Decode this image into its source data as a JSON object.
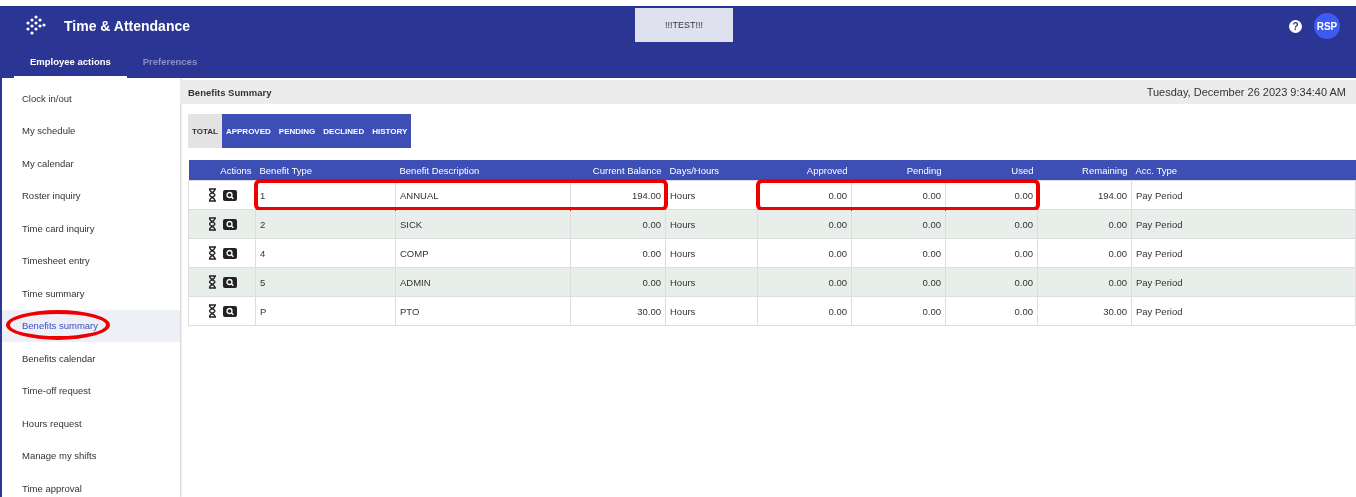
{
  "app": {
    "title": "Time & Attendance",
    "environment_badge": "!!!TEST!!!",
    "help": "?",
    "avatar": "RSP"
  },
  "nav_tabs": [
    {
      "label": "Employee actions",
      "selected": true
    },
    {
      "label": "Preferences",
      "selected": false
    }
  ],
  "sidebar": {
    "items": [
      {
        "label": "Clock in/out",
        "selected": false,
        "circled": false
      },
      {
        "label": "My schedule",
        "selected": false,
        "circled": false
      },
      {
        "label": "My calendar",
        "selected": false,
        "circled": false
      },
      {
        "label": "Roster inquiry",
        "selected": false,
        "circled": false
      },
      {
        "label": "Time card inquiry",
        "selected": false,
        "circled": false
      },
      {
        "label": "Timesheet entry",
        "selected": false,
        "circled": false
      },
      {
        "label": "Time summary",
        "selected": false,
        "circled": false
      },
      {
        "label": "Benefits summary",
        "selected": true,
        "circled": true
      },
      {
        "label": "Benefits calendar",
        "selected": false,
        "circled": false
      },
      {
        "label": "Time-off request",
        "selected": false,
        "circled": false
      },
      {
        "label": "Hours request",
        "selected": false,
        "circled": false
      },
      {
        "label": "Manage my shifts",
        "selected": false,
        "circled": false
      },
      {
        "label": "Time approval",
        "selected": false,
        "circled": false
      }
    ]
  },
  "page": {
    "title": "Benefits Summary",
    "datetime": "Tuesday, December 26 2023 9:34:40 AM"
  },
  "view_tabs": [
    {
      "label": "TOTAL",
      "selected": true
    },
    {
      "label": "APPROVED",
      "selected": false
    },
    {
      "label": "PENDING",
      "selected": false
    },
    {
      "label": "DECLINED",
      "selected": false
    },
    {
      "label": "HISTORY",
      "selected": false
    }
  ],
  "table": {
    "columns": [
      {
        "label": "Actions",
        "kind": "actions"
      },
      {
        "label": "Benefit Type",
        "kind": "text"
      },
      {
        "label": "Benefit Description",
        "kind": "text"
      },
      {
        "label": "Current Balance",
        "kind": "number"
      },
      {
        "label": "Days/Hours",
        "kind": "text"
      },
      {
        "label": "Approved",
        "kind": "number"
      },
      {
        "label": "Pending",
        "kind": "number"
      },
      {
        "label": "Used",
        "kind": "number"
      },
      {
        "label": "Remaining",
        "kind": "number"
      },
      {
        "label": "Acc. Type",
        "kind": "text"
      }
    ],
    "rows": [
      {
        "cells": [
          {
            "kind": "actions"
          },
          {
            "kind": "text",
            "text": "1",
            "boxed": true
          },
          {
            "kind": "text",
            "text": "ANNUAL",
            "boxed": true
          },
          {
            "kind": "text",
            "text": "194.00",
            "boxed": true
          },
          {
            "kind": "text",
            "text": "Hours",
            "boxed": false
          },
          {
            "kind": "text",
            "text": "0.00",
            "boxed": true
          },
          {
            "kind": "text",
            "text": "0.00",
            "boxed": true
          },
          {
            "kind": "text",
            "text": "0.00",
            "boxed": true
          },
          {
            "kind": "text",
            "text": "194.00",
            "boxed": false
          },
          {
            "kind": "text",
            "text": "Pay Period",
            "boxed": false
          }
        ]
      },
      {
        "cells": [
          {
            "kind": "actions"
          },
          {
            "kind": "text",
            "text": "2",
            "boxed": false
          },
          {
            "kind": "text",
            "text": "SICK",
            "boxed": false
          },
          {
            "kind": "text",
            "text": "0.00",
            "boxed": false
          },
          {
            "kind": "text",
            "text": "Hours",
            "boxed": false
          },
          {
            "kind": "text",
            "text": "0.00",
            "boxed": false
          },
          {
            "kind": "text",
            "text": "0.00",
            "boxed": false
          },
          {
            "kind": "text",
            "text": "0.00",
            "boxed": false
          },
          {
            "kind": "text",
            "text": "0.00",
            "boxed": false
          },
          {
            "kind": "text",
            "text": "Pay Period",
            "boxed": false
          }
        ]
      },
      {
        "cells": [
          {
            "kind": "actions"
          },
          {
            "kind": "text",
            "text": "4",
            "boxed": false
          },
          {
            "kind": "text",
            "text": "COMP",
            "boxed": false
          },
          {
            "kind": "text",
            "text": "0.00",
            "boxed": false
          },
          {
            "kind": "text",
            "text": "Hours",
            "boxed": false
          },
          {
            "kind": "text",
            "text": "0.00",
            "boxed": false
          },
          {
            "kind": "text",
            "text": "0.00",
            "boxed": false
          },
          {
            "kind": "text",
            "text": "0.00",
            "boxed": false
          },
          {
            "kind": "text",
            "text": "0.00",
            "boxed": false
          },
          {
            "kind": "text",
            "text": "Pay Period",
            "boxed": false
          }
        ]
      },
      {
        "cells": [
          {
            "kind": "actions"
          },
          {
            "kind": "text",
            "text": "5",
            "boxed": false
          },
          {
            "kind": "text",
            "text": "ADMIN",
            "boxed": false
          },
          {
            "kind": "text",
            "text": "0.00",
            "boxed": false
          },
          {
            "kind": "text",
            "text": "Hours",
            "boxed": false
          },
          {
            "kind": "text",
            "text": "0.00",
            "boxed": false
          },
          {
            "kind": "text",
            "text": "0.00",
            "boxed": false
          },
          {
            "kind": "text",
            "text": "0.00",
            "boxed": false
          },
          {
            "kind": "text",
            "text": "0.00",
            "boxed": false
          },
          {
            "kind": "text",
            "text": "Pay Period",
            "boxed": false
          }
        ]
      },
      {
        "cells": [
          {
            "kind": "actions"
          },
          {
            "kind": "text",
            "text": "P",
            "boxed": false
          },
          {
            "kind": "text",
            "text": "PTO",
            "boxed": false
          },
          {
            "kind": "text",
            "text": "30.00",
            "boxed": false
          },
          {
            "kind": "text",
            "text": "Hours",
            "boxed": false
          },
          {
            "kind": "text",
            "text": "0.00",
            "boxed": false
          },
          {
            "kind": "text",
            "text": "0.00",
            "boxed": false
          },
          {
            "kind": "text",
            "text": "0.00",
            "boxed": false
          },
          {
            "kind": "text",
            "text": "30.00",
            "boxed": false
          },
          {
            "kind": "text",
            "text": "Pay Period",
            "boxed": false
          }
        ]
      }
    ]
  }
}
